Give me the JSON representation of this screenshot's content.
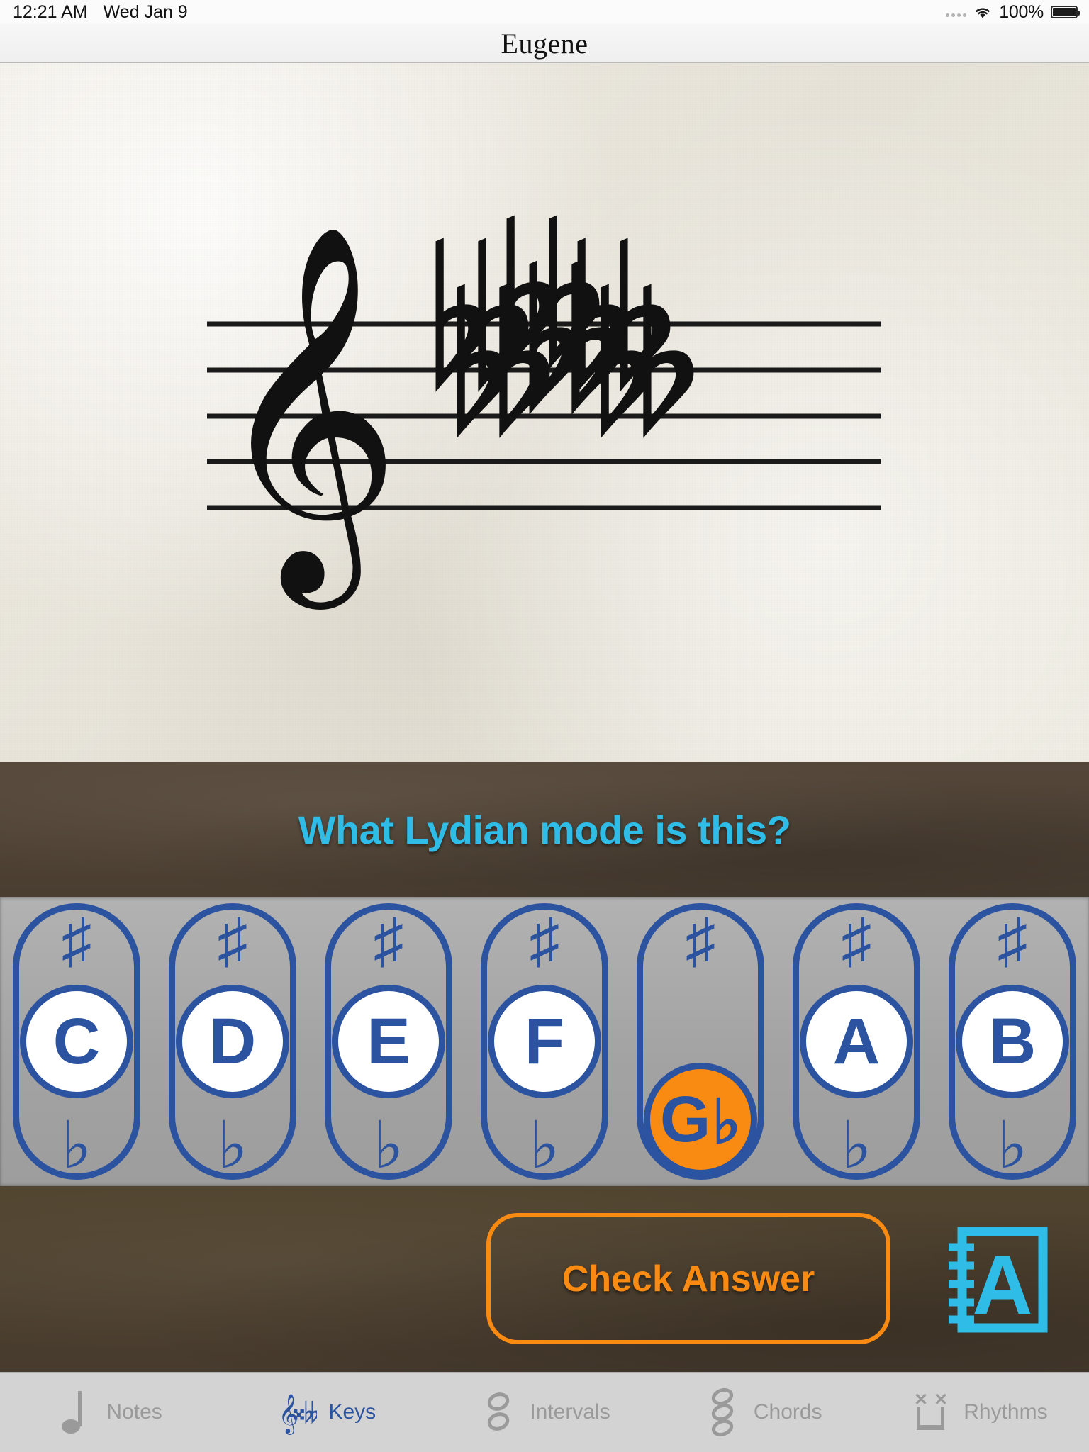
{
  "status_bar": {
    "time": "12:21 AM",
    "date": "Wed Jan 9",
    "signal_icon": "signal-dots-icon",
    "wifi_icon": "wifi-icon",
    "battery_percent": "100%",
    "battery_icon": "battery-full-icon"
  },
  "nav": {
    "title": "Eugene"
  },
  "staff": {
    "clef_icon": "treble-clef-icon",
    "clef": "treble",
    "key_signature_type": "flats",
    "key_signature_count": 6,
    "key_signature_accidentals": [
      "B♭",
      "E♭",
      "A♭",
      "D♭",
      "G♭",
      "C♭"
    ],
    "staff_line_count": 5
  },
  "question": {
    "text": "What Lydian mode is this?",
    "color": "#2fbde8"
  },
  "selector": {
    "sharp_symbol": "♯",
    "flat_symbol": "♭",
    "selected_index": 4,
    "selected_color": "#f98a12",
    "outline_color": "#2b53a0",
    "notes": [
      {
        "letter": "C",
        "state": "natural",
        "display": "C"
      },
      {
        "letter": "D",
        "state": "natural",
        "display": "D"
      },
      {
        "letter": "E",
        "state": "natural",
        "display": "E"
      },
      {
        "letter": "F",
        "state": "natural",
        "display": "F"
      },
      {
        "letter": "G",
        "state": "flat",
        "display": "G♭"
      },
      {
        "letter": "A",
        "state": "natural",
        "display": "A"
      },
      {
        "letter": "B",
        "state": "natural",
        "display": "B"
      }
    ]
  },
  "actions": {
    "check_label": "Check Answer",
    "check_color": "#f98a12",
    "book_icon": "notebook-a-icon",
    "book_icon_letter": "A",
    "book_icon_color": "#2fbde8"
  },
  "tabs": [
    {
      "label": "Notes",
      "icon": "quarter-note-icon",
      "active": false
    },
    {
      "label": "Keys",
      "icon": "clef-key-icon",
      "active": true
    },
    {
      "label": "Intervals",
      "icon": "interval-icon",
      "active": false
    },
    {
      "label": "Chords",
      "icon": "chord-icon",
      "active": false
    },
    {
      "label": "Rhythms",
      "icon": "rhythm-icon",
      "active": false
    }
  ]
}
